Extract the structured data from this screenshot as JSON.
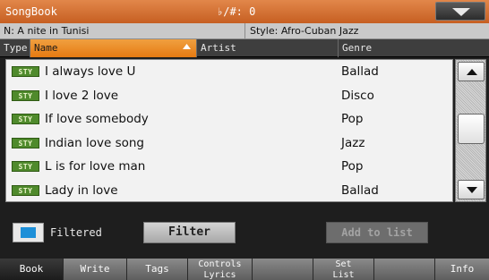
{
  "titlebar": {
    "title": "SongBook",
    "accidentals": "♭/#: 0"
  },
  "info": {
    "song_name": "N: A nite in Tunisi",
    "style_name": "Style: Afro-Cuban Jazz"
  },
  "columns": {
    "type": "Type",
    "name": "Name",
    "artist": "Artist",
    "genre": "Genre"
  },
  "rows": [
    {
      "type": "STY",
      "name": "I always love U",
      "artist": "",
      "genre": "Ballad"
    },
    {
      "type": "STY",
      "name": "I love 2 love",
      "artist": "",
      "genre": "Disco"
    },
    {
      "type": "STY",
      "name": "If love somebody",
      "artist": "",
      "genre": "Pop"
    },
    {
      "type": "STY",
      "name": "Indian love song",
      "artist": "",
      "genre": "Jazz"
    },
    {
      "type": "STY",
      "name": "L is for love man",
      "artist": "",
      "genre": "Pop"
    },
    {
      "type": "STY",
      "name": "Lady in love",
      "artist": "",
      "genre": "Ballad"
    }
  ],
  "controls": {
    "filtered_label": "Filtered",
    "filtered_checked": true,
    "filter_button": "Filter",
    "add_to_list_button": "Add to list"
  },
  "tabs": [
    {
      "label": "Book",
      "active": true
    },
    {
      "label": "Write",
      "active": false
    },
    {
      "label": "Tags",
      "active": false
    },
    {
      "label": "Controls",
      "label2": "Lyrics",
      "active": false
    },
    {
      "label": "",
      "active": false
    },
    {
      "label": "Set",
      "label2": "List",
      "active": false
    },
    {
      "label": "",
      "active": false
    },
    {
      "label": "Info",
      "active": false
    }
  ],
  "colors": {
    "accent": "#e67a12",
    "badge": "#4f8a2c",
    "checkbox_fill": "#1d8fd8"
  },
  "icons": {
    "menu": "chevron-down-icon",
    "scroll_up": "arrow-up-icon",
    "scroll_down": "arrow-down-icon",
    "sort": "sort-up-icon"
  }
}
